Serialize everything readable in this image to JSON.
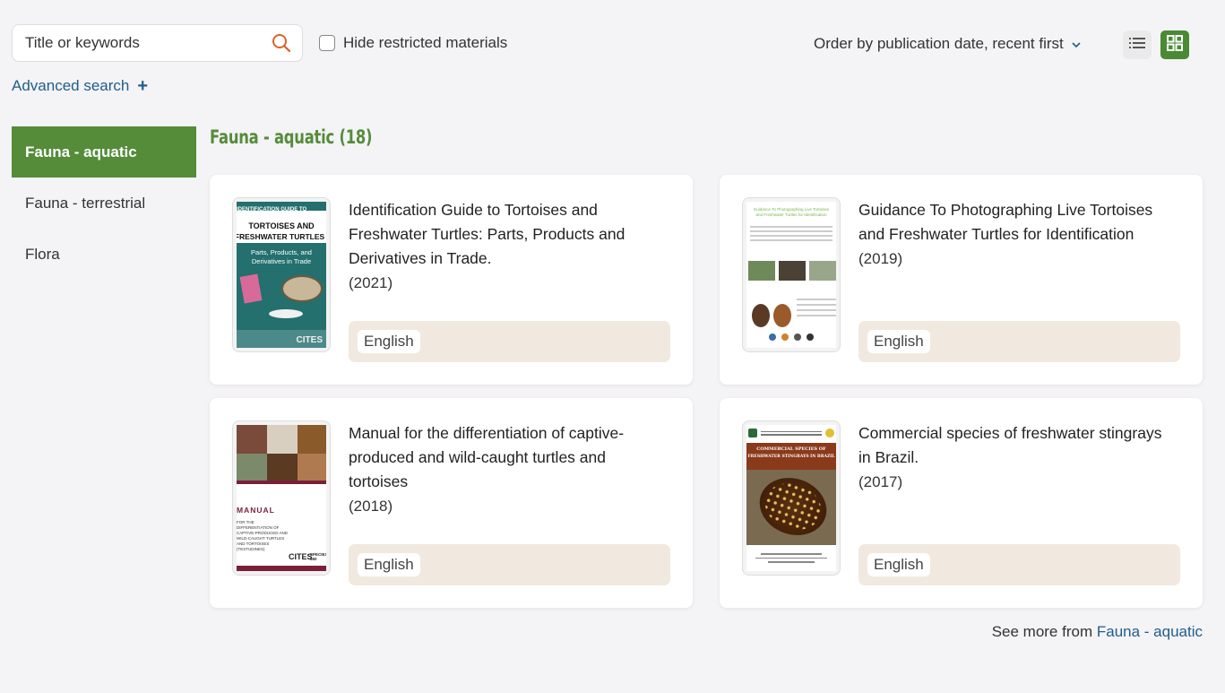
{
  "search": {
    "placeholder": "Title or keywords"
  },
  "filters": {
    "hide_restricted_label": "Hide restricted materials"
  },
  "sort": {
    "label": "Order by publication date, recent first"
  },
  "advanced_search": {
    "label": "Advanced search",
    "plus": "+"
  },
  "sidebar": {
    "items": [
      {
        "label": "Fauna - aquatic",
        "active": true
      },
      {
        "label": "Fauna - terrestrial",
        "active": false
      },
      {
        "label": "Flora",
        "active": false
      }
    ]
  },
  "section": {
    "title": "Fauna - aquatic (18)"
  },
  "cards": [
    {
      "title": "Identification Guide to Tortoises and Freshwater Turtles: Parts, Products and Derivatives in Trade.",
      "year": "(2021)",
      "language": "English",
      "cover": {
        "line1": "IDENTIFICATION GUIDE TO",
        "line2": "TORTOISES AND",
        "line3": "FRESHWATER TURTLES",
        "line4": "Parts, Products, and",
        "line5": "Derivatives in Trade",
        "logo": "CITES"
      }
    },
    {
      "title": "Guidance To Photographing Live Tortoises and Freshwater Turtles for Identification",
      "year": "(2019)",
      "language": "English",
      "cover": {
        "line1": "Guidance To Photographing Live Tortoises",
        "line2": "and Freshwater Turtles for Identification"
      }
    },
    {
      "title": "Manual for the differentiation of captive-produced and wild-caught turtles and tortoises",
      "year": "(2018)",
      "language": "English",
      "cover": {
        "line1": "MANUAL",
        "line2": "FOR THE",
        "line3": "DIFFERENTIATION OF",
        "line4": "CAPTIVE-PRODUCED AND",
        "line5": "WILD-CAUGHT TURTLES",
        "line6": "AND TORTOISES",
        "line7": "(TESTUDINES)",
        "logo": "CITES",
        "badge": "SPECIES 360"
      }
    },
    {
      "title": "Commercial species of freshwater stingrays in Brazil.",
      "year": "(2017)",
      "language": "English",
      "cover": {
        "line1": "COMMERCIAL SPECIES OF",
        "line2": "FRESHWATER STINGRAYS IN BRAZIL"
      }
    }
  ],
  "see_more": {
    "prefix": "See more from",
    "link": "Fauna - aquatic"
  },
  "colors": {
    "brand_green": "#548c3a",
    "link_blue": "#1f5e8a",
    "lang_bg": "#f1e9e0",
    "search_icon": "#d9622b"
  }
}
